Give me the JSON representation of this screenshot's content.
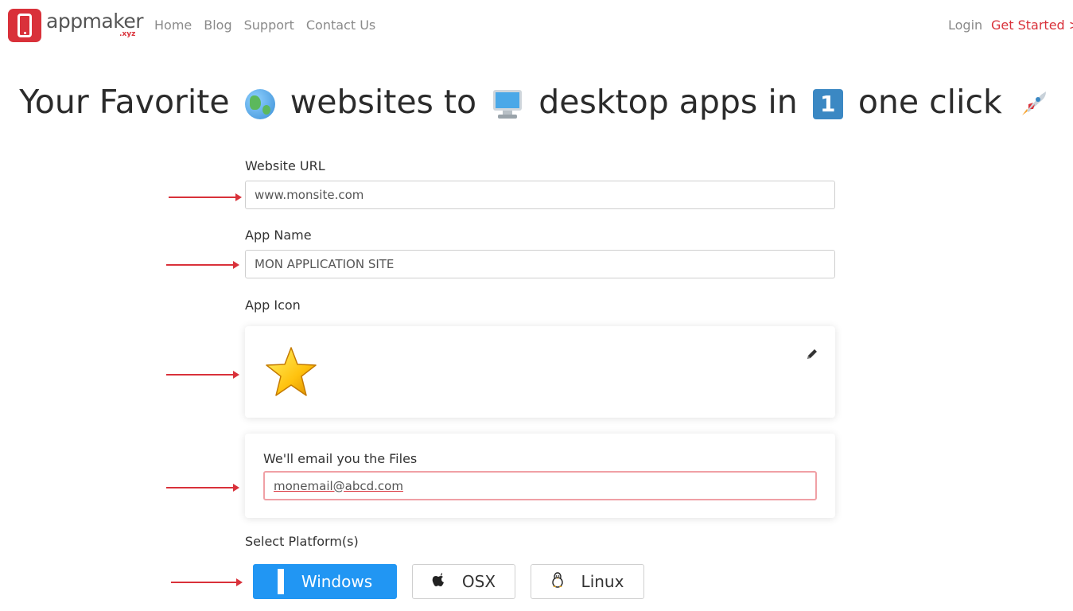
{
  "nav": {
    "brand": "appmaker",
    "brand_sub": ".xyz",
    "links": [
      "Home",
      "Blog",
      "Support",
      "Contact Us"
    ],
    "login": "Login",
    "get_started": "Get Started >"
  },
  "hero": {
    "part1": "Your Favorite",
    "part2": "websites to",
    "part3": "desktop apps in",
    "part4": "one click",
    "number_badge": "1",
    "icons": [
      "globe-icon",
      "desktop-computer-icon",
      "number-one-icon",
      "rocket-icon"
    ]
  },
  "form": {
    "url_label": "Website URL",
    "url_value": "www.monsite.com",
    "name_label": "App Name",
    "name_value": "MON APPLICATION SITE",
    "icon_label": "App Icon",
    "icon_name": "star-icon",
    "email_label": "We'll email you the Files",
    "email_value": "monemail@abcd.com",
    "platform_label": "Select Platform(s)",
    "platforms": [
      {
        "label": "Windows",
        "icon": "windows-icon",
        "selected": true
      },
      {
        "label": "OSX",
        "icon": "apple-icon",
        "selected": false
      },
      {
        "label": "Linux",
        "icon": "linux-icon",
        "selected": false
      }
    ]
  },
  "colors": {
    "brand_red": "#d9313a",
    "primary_blue": "#2196f3",
    "annotation_arrow": "#d9313a"
  }
}
